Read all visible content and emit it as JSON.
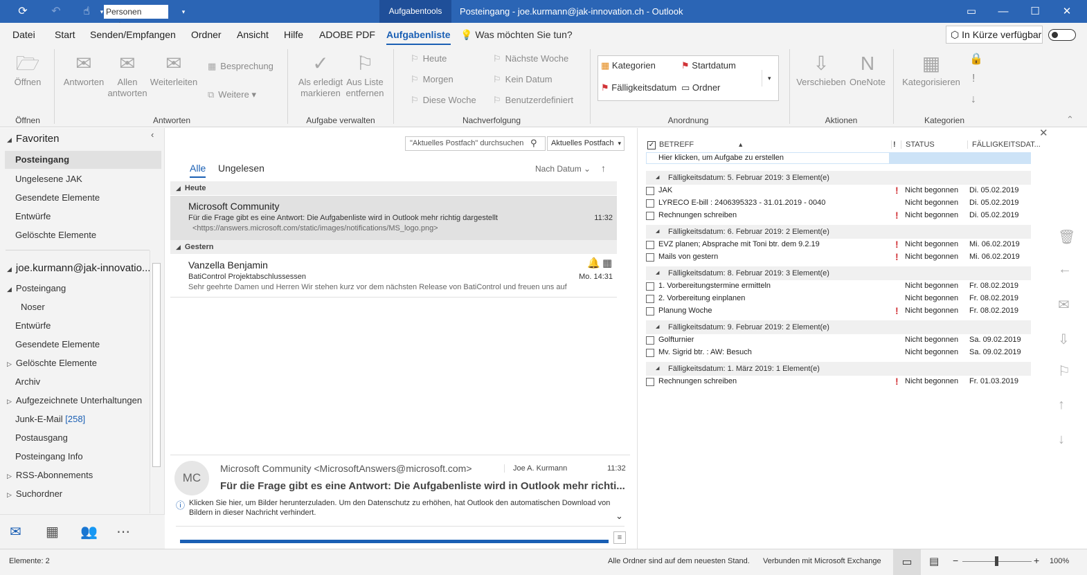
{
  "titlebar": {
    "people_search_placeholder": "Personen suchen",
    "context_tab": "Aufgabentools",
    "window_title": "Posteingang - joe.kurmann@jak-innovation.ch  -  Outlook"
  },
  "menu": {
    "items": [
      "Datei",
      "Start",
      "Senden/Empfangen",
      "Ordner",
      "Ansicht",
      "Hilfe",
      "ADOBE PDF",
      "Aufgabenliste"
    ],
    "tell_me": "Was möchten Sie tun?",
    "coming_soon": "In Kürze verfügbar"
  },
  "ribbon": {
    "open": "Öffnen",
    "reply": "Antworten",
    "reply_all_1": "Allen",
    "reply_all_2": "antworten",
    "forward": "Weiterleiten",
    "meeting": "Besprechung",
    "more": "Weitere",
    "mark_done_1": "Als erledigt",
    "mark_done_2": "markieren",
    "remove_1": "Aus Liste",
    "remove_2": "entfernen",
    "today": "Heute",
    "tomorrow": "Morgen",
    "this_week": "Diese Woche",
    "next_week": "Nächste Woche",
    "no_date": "Kein Datum",
    "custom": "Benutzerdefiniert",
    "categories": "Kategorien",
    "start_date": "Startdatum",
    "due_date": "Fälligkeitsdatum",
    "folder": "Ordner",
    "move": "Verschieben",
    "onenote": "OneNote",
    "categorize": "Kategorisieren",
    "groups": [
      "Öffnen",
      "Antworten",
      "Aufgabe verwalten",
      "Nachverfolgung",
      "Anordnung",
      "Aktionen",
      "Kategorien"
    ]
  },
  "nav": {
    "favorites": "Favoriten",
    "fav_items": [
      "Posteingang",
      "Ungelesene JAK",
      "Gesendete Elemente",
      "Entwürfe",
      "Gelöschte Elemente"
    ],
    "account": "joe.kurmann@jak-innovatio...",
    "inbox": "Posteingang",
    "noser": "Noser",
    "drafts": "Entwürfe",
    "sent": "Gesendete Elemente",
    "deleted": "Gelöschte Elemente",
    "archive": "Archiv",
    "recorded": "Aufgezeichnete Unterhaltungen",
    "junk": "Junk-E-Mail",
    "junk_count": "[258]",
    "outbox": "Postausgang",
    "inbox_info": "Posteingang Info",
    "rss": "RSS-Abonnements",
    "search_folders": "Suchordner"
  },
  "list": {
    "search_placeholder": "\"Aktuelles Postfach\" durchsuchen",
    "scope": "Aktuelles Postfach",
    "tab_all": "Alle",
    "tab_unread": "Ungelesen",
    "sort": "Nach Datum",
    "group_today": "Heute",
    "group_yesterday": "Gestern",
    "messages": [
      {
        "from": "Microsoft Community",
        "subject": "Für die Frage gibt es eine Antwort: Die Aufgabenliste wird in Outlook mehr richtig dargestellt",
        "preview": "<https://answers.microsoft.com/static/images/notifications/MS_logo.png>",
        "time": "11:32"
      },
      {
        "from": "Vanzella Benjamin",
        "subject": "BatiControl Projektabschlussessen",
        "preview": "Sehr geehrte Damen und Herren  Wir stehen kurz vor dem nächsten Release von BatiControl und freuen uns auf",
        "time": "Mo. 14:31"
      }
    ]
  },
  "reading": {
    "initials": "MC",
    "sender": "Microsoft Community <MicrosoftAnswers@microsoft.com>",
    "to": "Joe A. Kurmann",
    "time": "11:32",
    "subject": "Für die Frage gibt es eine Antwort: Die Aufgabenliste wird in Outlook mehr richti...",
    "info_1": "Klicken Sie hier, um Bilder herunterzuladen. Um den Datenschutz zu erhöhen, hat Outlook den automatischen Download von",
    "info_2": "Bildern in dieser Nachricht verhindert."
  },
  "tasks": {
    "col_subject": "BETREFF",
    "col_imp": "!",
    "col_status": "STATUS",
    "col_due": "FÄLLIGKEITSDAT...",
    "new_task": "Hier klicken, um Aufgabe zu erstellen",
    "groups": [
      "Fälligkeitsdatum: 5. Februar 2019: 3 Element(e)",
      "Fälligkeitsdatum: 6. Februar 2019: 2 Element(e)",
      "Fälligkeitsdatum: 8. Februar 2019: 3 Element(e)",
      "Fälligkeitsdatum: 9. Februar 2019: 2 Element(e)",
      "Fälligkeitsdatum: 1. März 2019: 1 Element(e)"
    ],
    "rows": [
      {
        "subject": "JAK",
        "imp": "!",
        "status": "Nicht begonnen",
        "due": "Di. 05.02.2019"
      },
      {
        "subject": "LYRECO E-bill : 2406395323 - 31.01.2019 - 0040",
        "imp": "",
        "status": "Nicht begonnen",
        "due": "Di. 05.02.2019"
      },
      {
        "subject": "Rechnungen schreiben",
        "imp": "!",
        "status": "Nicht begonnen",
        "due": "Di. 05.02.2019"
      },
      {
        "subject": "EVZ planen; Absprache mit Toni btr. dem 9.2.19",
        "imp": "!",
        "status": "Nicht begonnen",
        "due": "Mi. 06.02.2019"
      },
      {
        "subject": "Mails von gestern",
        "imp": "!",
        "status": "Nicht begonnen",
        "due": "Mi. 06.02.2019"
      },
      {
        "subject": "1. Vorbereitungstermine ermitteln",
        "imp": "",
        "status": "Nicht begonnen",
        "due": "Fr. 08.02.2019"
      },
      {
        "subject": "2. Vorbereitung einplanen",
        "imp": "",
        "status": "Nicht begonnen",
        "due": "Fr. 08.02.2019"
      },
      {
        "subject": "Planung Woche",
        "imp": "!",
        "status": "Nicht begonnen",
        "due": "Fr. 08.02.2019"
      },
      {
        "subject": "Golfturnier",
        "imp": "",
        "status": "Nicht begonnen",
        "due": "Sa. 09.02.2019"
      },
      {
        "subject": "Mv. Sigrid btr. : AW: Besuch",
        "imp": "",
        "status": "Nicht begonnen",
        "due": "Sa. 09.02.2019"
      },
      {
        "subject": "Rechnungen schreiben",
        "imp": "!",
        "status": "Nicht begonnen",
        "due": "Fr. 01.03.2019"
      }
    ]
  },
  "status": {
    "items": "Elemente: 2",
    "sync": "Alle Ordner sind auf dem neuesten Stand.",
    "connection": "Verbunden mit Microsoft Exchange",
    "zoom": "100%"
  },
  "colors": {
    "title_bg": "#2b65b5",
    "accent": "#1a5fb4",
    "importance": "#d13438"
  },
  "icons": [
    "refresh-icon",
    "undo-icon",
    "touch-mode-icon",
    "mail-icon",
    "calendar-icon",
    "people-icon",
    "more-icon"
  ]
}
